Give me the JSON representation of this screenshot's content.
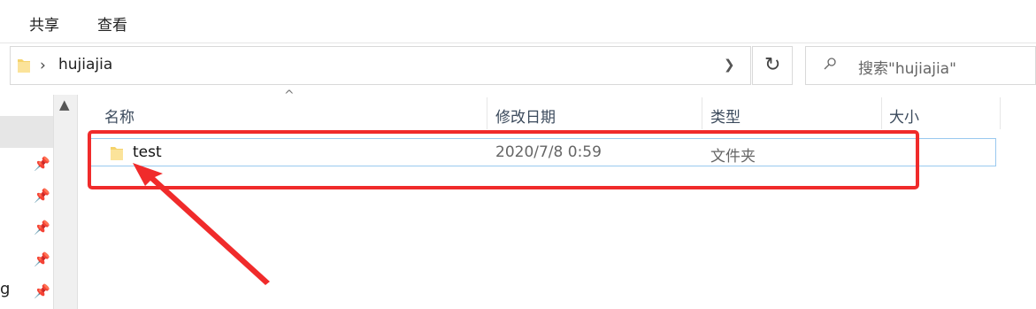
{
  "ribbon": {
    "tabs": [
      "共享",
      "查看"
    ]
  },
  "address": {
    "path_segment": "hujiajia",
    "separator": "›"
  },
  "search": {
    "placeholder": "搜索\"hujiajia\""
  },
  "columns": {
    "name": "名称",
    "date": "修改日期",
    "type": "类型",
    "size": "大小"
  },
  "files": [
    {
      "name": "test",
      "modified": "2020/7/8 0:59",
      "type": "文件夹",
      "size": ""
    }
  ],
  "nav": {
    "partial_label": "g"
  },
  "colors": {
    "annotation": "#f02b2b",
    "selection_border": "#99c9ef",
    "folder": "#f5d36b"
  }
}
